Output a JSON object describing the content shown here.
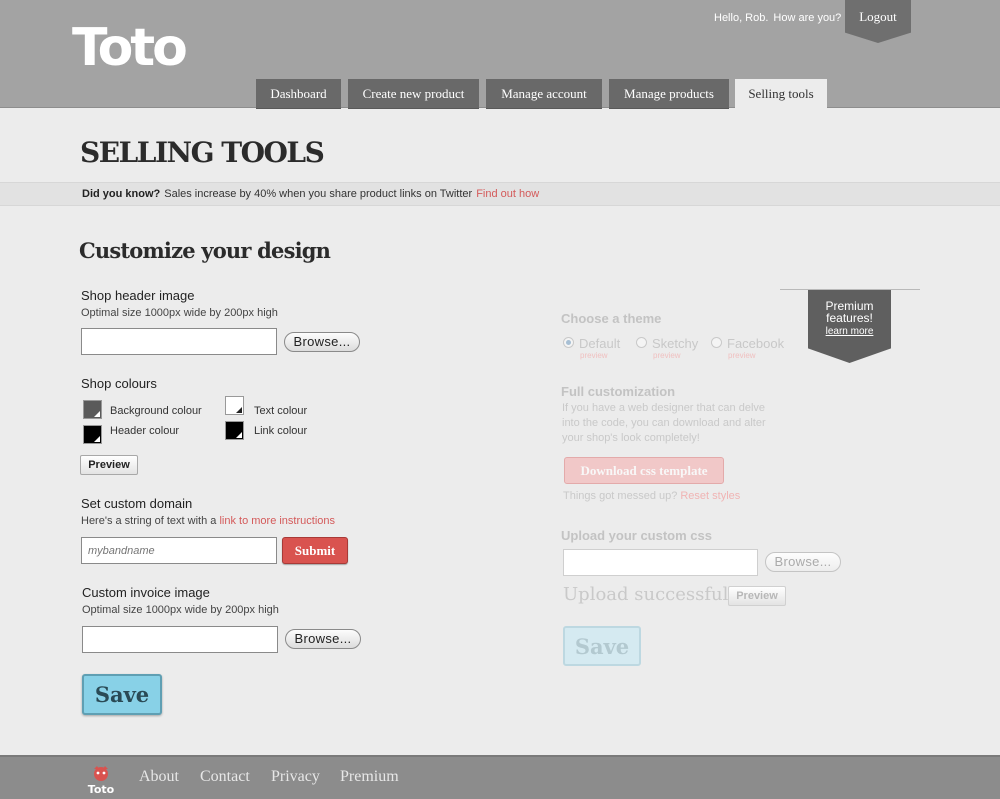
{
  "brand": {
    "logo_text": "Toto"
  },
  "header": {
    "greeting": "Hello, Rob.",
    "question": "How are you?",
    "logout_label": "Logout",
    "tabs": [
      {
        "label": "Dashboard",
        "active": false
      },
      {
        "label": "Create new product",
        "active": false
      },
      {
        "label": "Manage account",
        "active": false
      },
      {
        "label": "Manage products",
        "active": false
      },
      {
        "label": "Selling tools",
        "active": true
      }
    ]
  },
  "page": {
    "title": "SELLING TOOLS",
    "tip": {
      "prefix": "Did you know?",
      "text": "Sales increase by 40% when you share product links on Twitter",
      "link": "Find out how"
    }
  },
  "customize": {
    "title": "Customize your design",
    "header_image": {
      "label": "Shop header image",
      "hint": "Optimal size 1000px wide by 200px high",
      "value": "",
      "browse_label": "Browse..."
    },
    "colours": {
      "label": "Shop colours",
      "items": [
        {
          "label": "Background colour",
          "color": "#5a5a5a"
        },
        {
          "label": "Text colour",
          "color": "#ffffff"
        },
        {
          "label": "Header colour",
          "color": "#000000"
        },
        {
          "label": "Link colour",
          "color": "#000000"
        }
      ],
      "preview_label": "Preview"
    },
    "domain": {
      "label": "Set custom domain",
      "hint_prefix": "Here's a string of text with a",
      "hint_link": "link to more instructions",
      "placeholder": "mybandname",
      "submit_label": "Submit"
    },
    "invoice_image": {
      "label": "Custom invoice image",
      "hint": "Optimal size 1000px wide by 200px high",
      "value": "",
      "browse_label": "Browse..."
    },
    "save_label": "Save"
  },
  "premium": {
    "badge_title": "Premium features!",
    "badge_link": "learn more",
    "theme": {
      "label": "Choose a theme",
      "options": [
        {
          "label": "Default",
          "sub": "preview",
          "selected": true
        },
        {
          "label": "Sketchy",
          "sub": "preview",
          "selected": false
        },
        {
          "label": "Facebook",
          "sub": "preview",
          "selected": false
        }
      ]
    },
    "full": {
      "label": "Full customization",
      "desc": "If you have a web designer that can delve into the code, you can download and alter your shop's look completely!",
      "download_label": "Download css template",
      "note": "Things got messed up?",
      "reset_link": "Reset styles"
    },
    "upload": {
      "label": "Upload your custom css",
      "value": "",
      "browse_label": "Browse...",
      "status": "Upload successful!",
      "preview_label": "Preview"
    },
    "save_label": "Save"
  },
  "footer": {
    "logo_text": "Toto",
    "links": [
      "About",
      "Contact",
      "Privacy",
      "Premium"
    ]
  }
}
